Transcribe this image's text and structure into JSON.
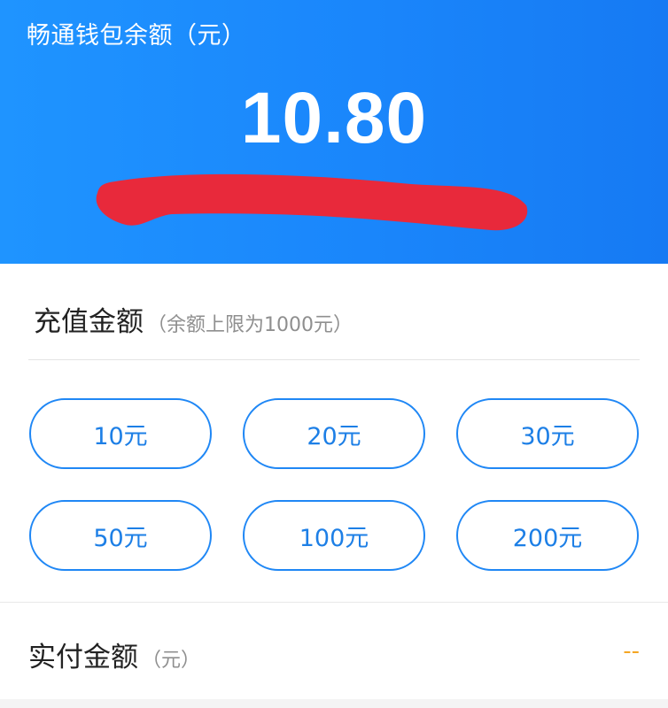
{
  "wallet": {
    "label": "畅通钱包余额（元）",
    "balance": "10.80"
  },
  "recharge": {
    "title": "充值金额",
    "hint": "（余额上限为1000元）",
    "amounts": [
      "10元",
      "20元",
      "30元",
      "50元",
      "100元",
      "200元"
    ]
  },
  "payment": {
    "label": "实付金额",
    "hint": "（元）",
    "value": "--"
  },
  "colors": {
    "header_blue": "#1a86fb",
    "button_border": "#1f87f5",
    "button_text": "#1d7fe6",
    "pay_value": "#f5a623",
    "redaction": "#e8293b"
  }
}
